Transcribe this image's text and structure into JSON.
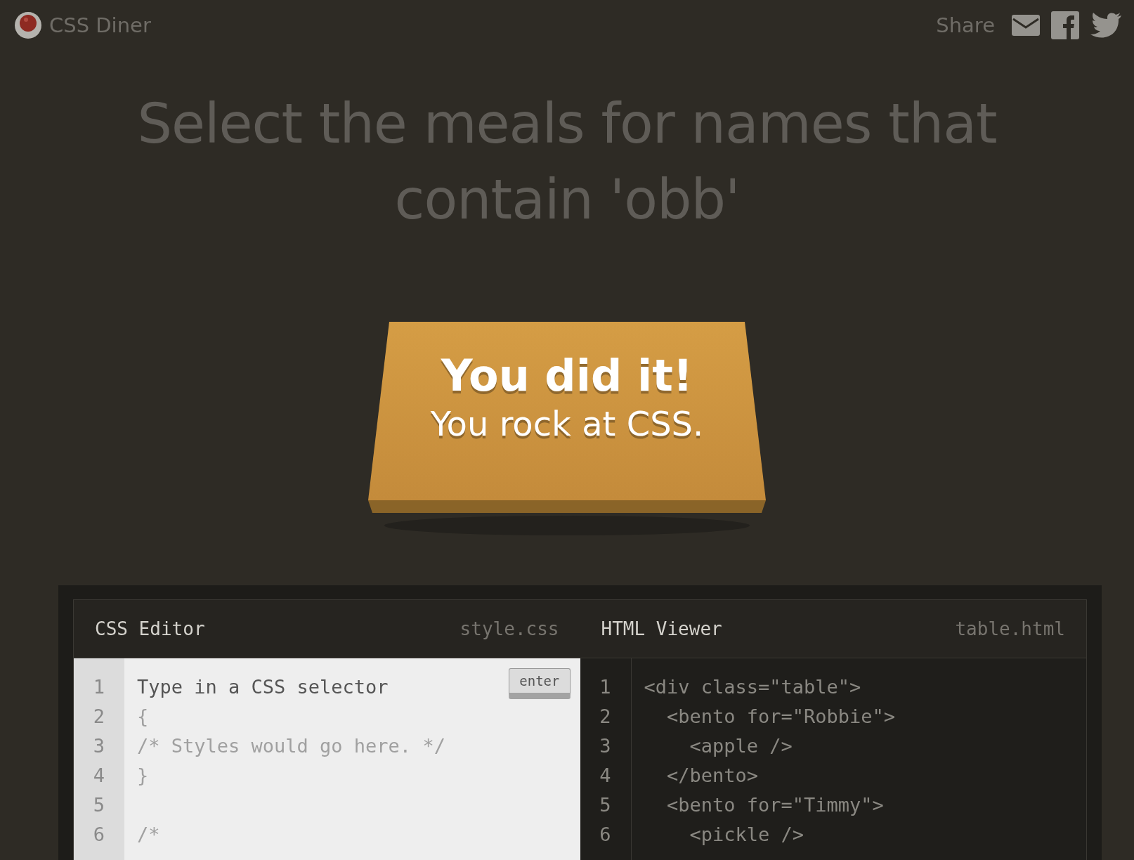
{
  "header": {
    "logo_text": "CSS Diner",
    "share_label": "Share"
  },
  "instruction": "Select the meals for names that contain 'obb'",
  "table": {
    "headline": "You did it!",
    "subline": "You rock at CSS."
  },
  "css_editor": {
    "title": "CSS Editor",
    "filename": "style.css",
    "input": {
      "placeholder": "Type in a CSS selector"
    },
    "enter_button": "enter",
    "lines": [
      {
        "number": "1"
      },
      {
        "number": "2",
        "code": "{"
      },
      {
        "number": "3",
        "code": "/* Styles would go here. */"
      },
      {
        "number": "4",
        "code": "}"
      },
      {
        "number": "5"
      },
      {
        "number": "6",
        "code": "/*"
      }
    ]
  },
  "html_viewer": {
    "title": "HTML Viewer",
    "filename": "table.html",
    "lines": [
      {
        "number": "1",
        "code": "<div class=\"table\">"
      },
      {
        "number": "2",
        "code": "  <bento for=\"Robbie\">"
      },
      {
        "number": "3",
        "code": "    <apple />"
      },
      {
        "number": "4",
        "code": "  </bento>"
      },
      {
        "number": "5",
        "code": "  <bento for=\"Timmy\">"
      },
      {
        "number": "6",
        "code": "    <pickle />"
      }
    ]
  }
}
